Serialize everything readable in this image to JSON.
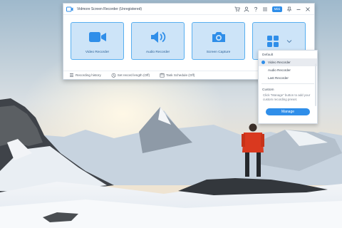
{
  "window": {
    "title": "Vidmore Screen Recorder (Unregistered)",
    "mini_label": "Mini",
    "titlebar_icons": [
      "cart-icon",
      "user-icon",
      "question-icon",
      "menu-icon"
    ],
    "window_controls": [
      "pin-icon",
      "minimize-icon",
      "close-icon"
    ]
  },
  "cards": [
    {
      "label": "Video Recorder",
      "icon": "video-camera-icon"
    },
    {
      "label": "Audio Recorder",
      "icon": "speaker-icon"
    },
    {
      "label": "Screen Capture",
      "icon": "camera-icon"
    },
    {
      "label": "",
      "icon": "grid-icon"
    }
  ],
  "statusbar": {
    "recording_history": "Recording history",
    "set_record_length": "Set record length (Off)",
    "task_schedule": "Task Schedule (Off)"
  },
  "dropdown": {
    "default_header": "Default",
    "items": [
      "Video Recorder",
      "Audio Recorder",
      "Last Recorder"
    ],
    "selected_index": 0,
    "custom_header": "Custom",
    "custom_desc": "Click \"Manage\" button to add your custom recording preset.",
    "manage_label": "Manage"
  },
  "colors": {
    "accent": "#2f8ee9",
    "card_bg": "#cde4f8",
    "card_border": "#58aff0",
    "jacket_red": "#d9391f"
  }
}
